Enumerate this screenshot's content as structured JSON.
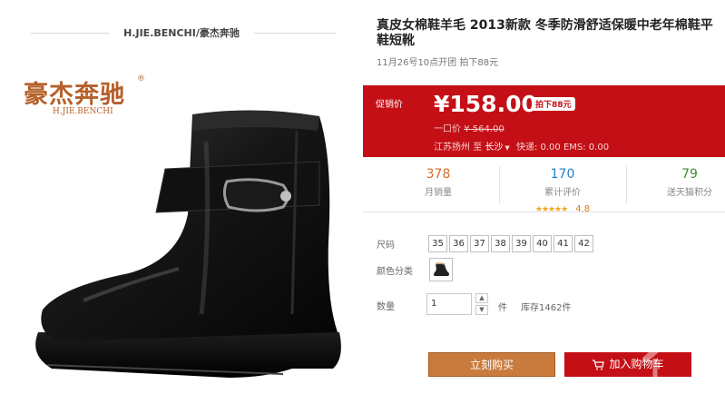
{
  "brand_header": {
    "text": "H.JIE.BENCHI/豪杰奔驰"
  },
  "logo": {
    "cn": "豪杰奔驰",
    "en": "H.JIE.BENCHI",
    "reg": "®"
  },
  "product": {
    "title_line1": "真皮女棉鞋羊毛 2013新款 冬季防滑舒适保暖中老年棉鞋平",
    "title_line2": "鞋短靴",
    "subtitle": "11月26号10点开团 拍下88元"
  },
  "price_box": {
    "label": "促销价",
    "price": "¥158.00",
    "drop_badge": "拍下88元",
    "orig_label": "一口价",
    "orig_value": "¥ 564.00",
    "ship_from": "江苏扬州",
    "ship_to_word": "至",
    "ship_dest": "长沙",
    "ship_fee": "快递: 0.00  EMS: 0.00",
    "colors": {
      "bg": "#c40f16",
      "badge_text": "#c40f16"
    }
  },
  "stats": {
    "sales_num": "378",
    "sales_label": "月销量",
    "reviews_num": "170",
    "reviews_label": "累计评价",
    "rating": "4.8",
    "stars": "★★★★★",
    "points_num": "79",
    "points_label": "送天猫积分"
  },
  "options": {
    "size_label": "尺码",
    "sizes": [
      "35",
      "36",
      "37",
      "38",
      "39",
      "40",
      "41",
      "42"
    ],
    "color_label": "颜色分类",
    "qty_label": "数量",
    "qty_value": "1",
    "unit": "件",
    "stock": "库存1462件"
  },
  "actions": {
    "buy": "立刻购买",
    "cart": "加入购物车"
  },
  "icons": {
    "stepper_up": "▲",
    "stepper_down": "▼",
    "caret": "▼",
    "cart": "cart-icon",
    "watermark": "house-icon"
  }
}
